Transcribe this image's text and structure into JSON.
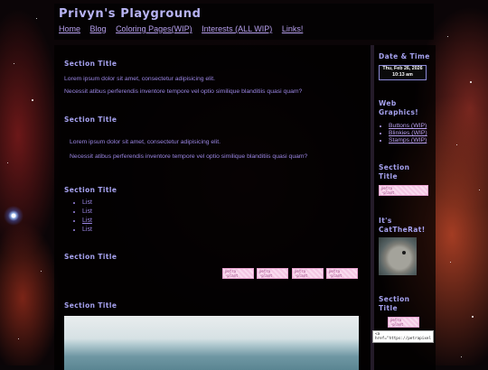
{
  "site": {
    "title": "Privyn's Playground"
  },
  "nav": [
    "Home",
    "Blog",
    "Coloring Pages(WIP)",
    "Interests (ALL WIP)",
    "Links!"
  ],
  "main": {
    "sections": [
      {
        "title": "Section Title",
        "paragraphs": [
          "Lorem ipsum dolor sit amet, consectetur adipisicing elit.",
          "Necessit atibus perferendis inventore tempore vel optio similique blanditiis quasi quam?"
        ]
      },
      {
        "title": "Section Title",
        "paragraphs": [
          "Lorem ipsum dolor sit amet, consectetur adipisicing elit.",
          "Necessit atibus perferendis inventore tempore vel optio similique blanditiis quasi quam?"
        ]
      },
      {
        "title": "Section Title",
        "list": [
          "List",
          "List",
          "List",
          "List"
        ]
      },
      {
        "title": "Section Title",
        "stamps": [
          "petra\n-plant",
          "petra\n-plant",
          "petra\n-plant",
          "petra\n-plant"
        ]
      },
      {
        "title": "Section Title"
      }
    ]
  },
  "sidebar": {
    "datetime": {
      "title": "Date & Time",
      "date": "Thu, Feb 26, 2026",
      "time": "10:13 am"
    },
    "graphics": {
      "title_line1": "Web",
      "title_line2": "Graphics!",
      "items": [
        "Buttons (WIP)",
        "Blinkies (WIP)",
        "Stamps (WIP)"
      ]
    },
    "section1": {
      "title_line1": "Section",
      "title_line2": "Title",
      "stamp": "petra\n-plant"
    },
    "cat": {
      "title_line1": "It's",
      "title_line2": "CatTheRat!"
    },
    "section2": {
      "title_line1": "Section",
      "title_line2": "Title",
      "stamp": "petra\n-plant",
      "code": "<a href=\"https://petrapixel"
    }
  }
}
